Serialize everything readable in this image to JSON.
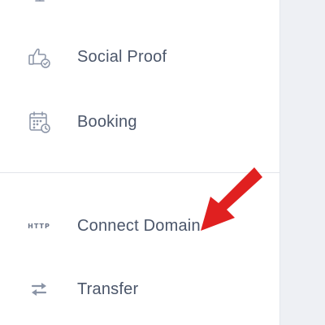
{
  "sidebar": {
    "items": [
      {
        "label": "Social Proof",
        "icon": "thumbs-up-check-icon"
      },
      {
        "label": "Booking",
        "icon": "calendar-clock-icon"
      },
      {
        "label": "Connect Domain",
        "icon": "http-icon",
        "icon_text": "HTTP"
      },
      {
        "label": "Transfer",
        "icon": "transfer-arrows-icon"
      }
    ]
  },
  "colors": {
    "label": "#4b566a",
    "icon": "#8a94a6",
    "divider": "#e2e5ea",
    "gutter": "#eef0f4",
    "pointer_arrow": "#e02020"
  }
}
